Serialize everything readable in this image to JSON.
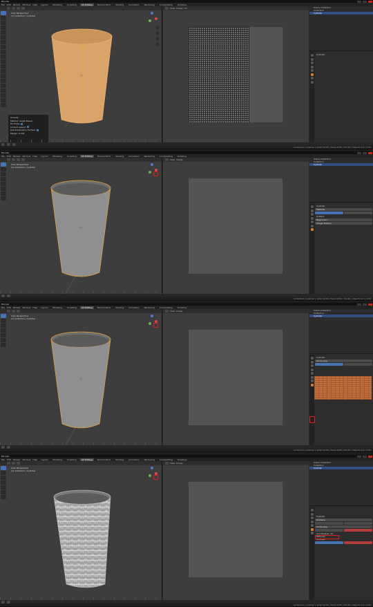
{
  "app": {
    "title": "Blender",
    "menus": [
      "File",
      "Edit",
      "Render",
      "Window",
      "Help"
    ],
    "workspaces": [
      "Layout",
      "Modeling",
      "Sculpting",
      "UV Editing",
      "Texture Paint",
      "Shading",
      "Animation",
      "Rendering",
      "Compositing",
      "Scripting"
    ],
    "active_workspace": "Layout",
    "scene_label": "Scene",
    "view_layer_label": "View Layer",
    "status_bar_text": "Collection | Cylinder | Verts:32/32 | Faces:0/30 | Tris:60 | Objects:1/1 | 2.80"
  },
  "viewport": {
    "view_name": "User Perspective",
    "collection_line": "(1) Collection | Cylinder",
    "mode_label": "Edit Mode"
  },
  "uv_editor": {
    "view_label": "View",
    "image_label": "Image",
    "uv_menu_label": "UV"
  },
  "operator_panel": {
    "title": "Unwrap",
    "rows": [
      "Method: Angle Based",
      "Fill Holes",
      "Correct Aspect",
      "Use Subdivision Surface",
      "Margin: 0.001"
    ]
  },
  "outliner": {
    "rows": [
      "Scene Collection",
      "Collection",
      "Cylinder"
    ]
  },
  "properties": {
    "texture_image_name": "bricks.png",
    "material_name": "Material",
    "modifier_name": "Displace",
    "material_slot": "Surface",
    "base_color_label": "Base Color",
    "image_texture_label": "Image Texture",
    "strength_label": "Strength",
    "midlevel_label": "Midlevel",
    "coordinates_label": "Coordinates",
    "uv_value": "UV"
  },
  "colors": {
    "selected_mesh": "#d8a46a",
    "mesh": "#8c8c8c",
    "outline": "#e8a13a",
    "accent": "#4772b3",
    "annotation": "#e02020"
  }
}
